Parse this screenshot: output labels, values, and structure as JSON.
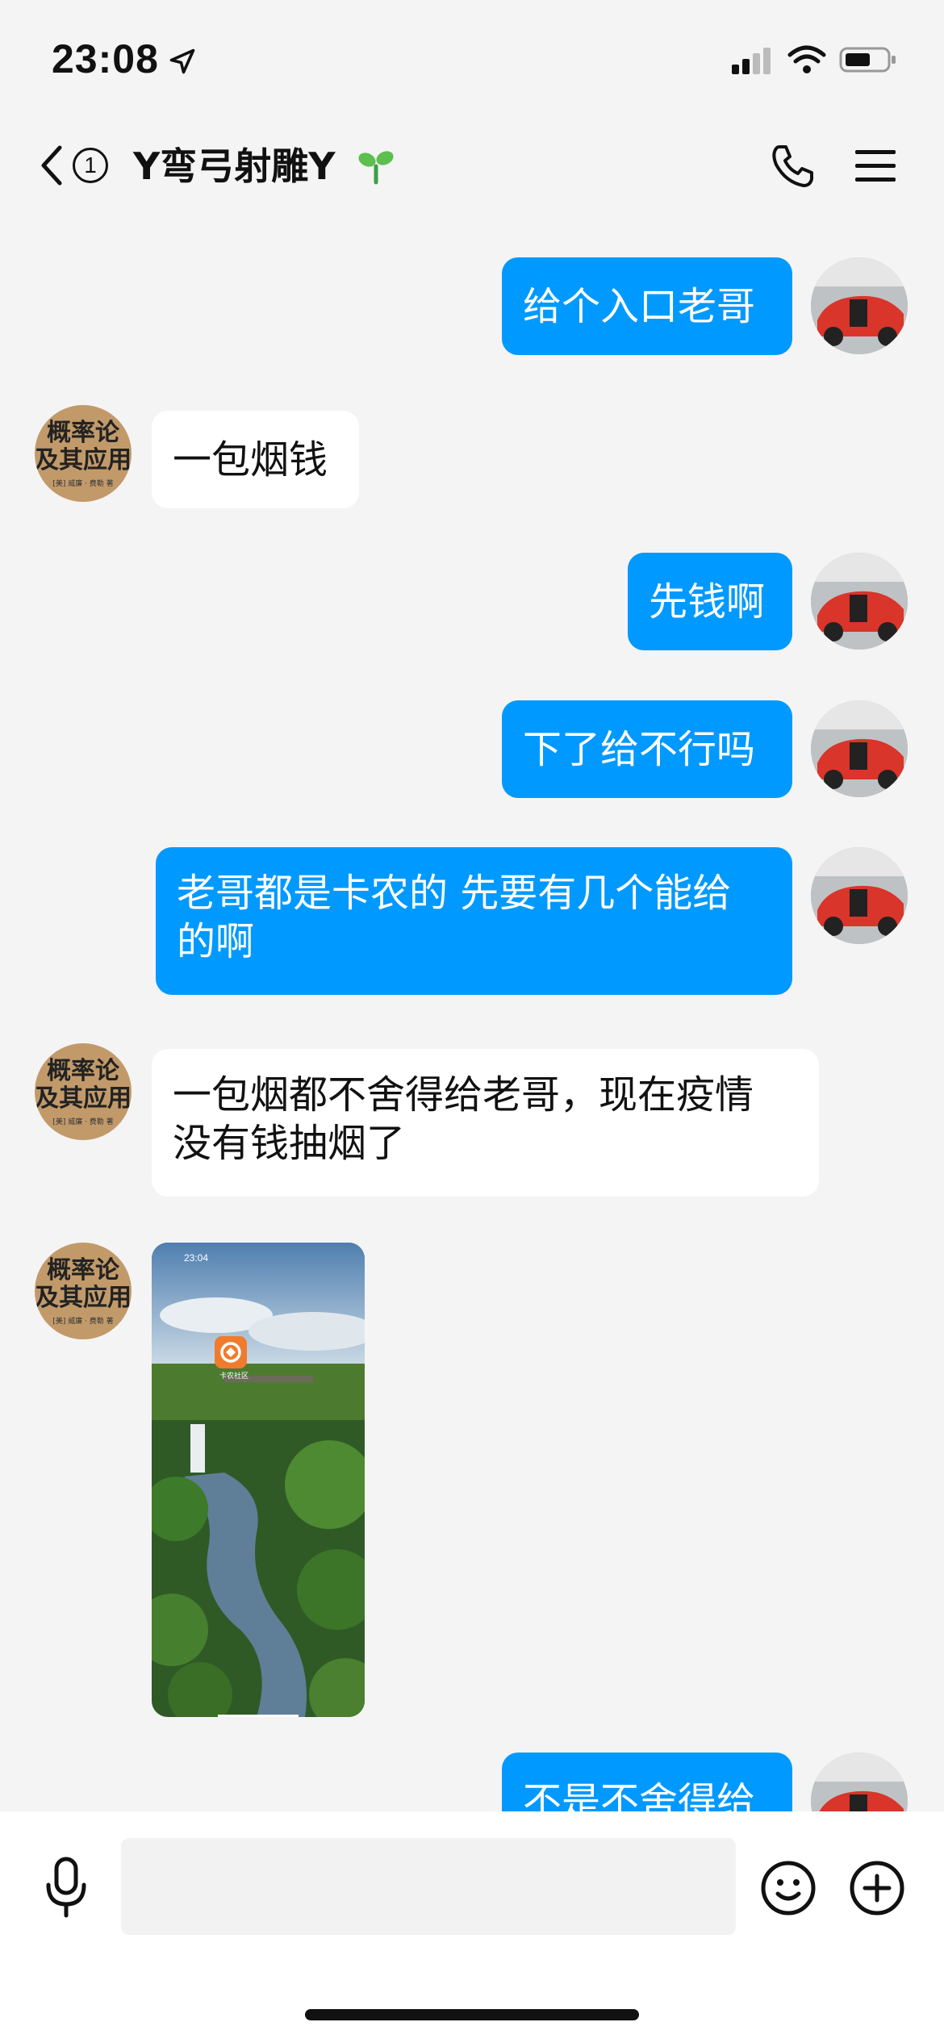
{
  "status_bar": {
    "time": "23:08",
    "icons": [
      "location-arrow-icon",
      "cellular-signal-icon",
      "wifi-icon",
      "battery-icon"
    ]
  },
  "header": {
    "back_icon": "chevron-left-icon",
    "unread_count": "1",
    "title": "Y弯弓射雕Y",
    "title_icon": "sprout-icon",
    "call_icon": "phone-icon",
    "menu_icon": "menu-icon"
  },
  "messages": [
    {
      "side": "out",
      "text": "给个入口老哥"
    },
    {
      "side": "in",
      "text": "一包烟钱"
    },
    {
      "side": "out",
      "text": "先钱啊"
    },
    {
      "side": "out",
      "text": "下了给不行吗"
    },
    {
      "side": "out",
      "lines": [
        "老哥都是卡农的 先要有几个能给",
        "的啊"
      ]
    },
    {
      "side": "in",
      "lines": [
        "一包烟都不舍得给老哥，现在疫情",
        "没有钱抽烟了"
      ]
    },
    {
      "side": "in",
      "type": "image",
      "image": {
        "time": "23:04",
        "app_label": "卡农社区"
      }
    },
    {
      "side": "out",
      "text": "不是不舍得给"
    }
  ],
  "contact_avatar": {
    "title_lines": [
      "概率论",
      "及其应用"
    ],
    "small_text": "[美] 威廉 · 费勒 著"
  },
  "bottom_bar": {
    "input_placeholder": "",
    "mic_icon": "microphone-icon",
    "emoji_icon": "smiley-icon",
    "plus_icon": "plus-circle-icon"
  },
  "colors": {
    "outgoing_bubble": "#0099ff",
    "incoming_bubble": "#ffffff",
    "background": "#f4f4f4"
  }
}
